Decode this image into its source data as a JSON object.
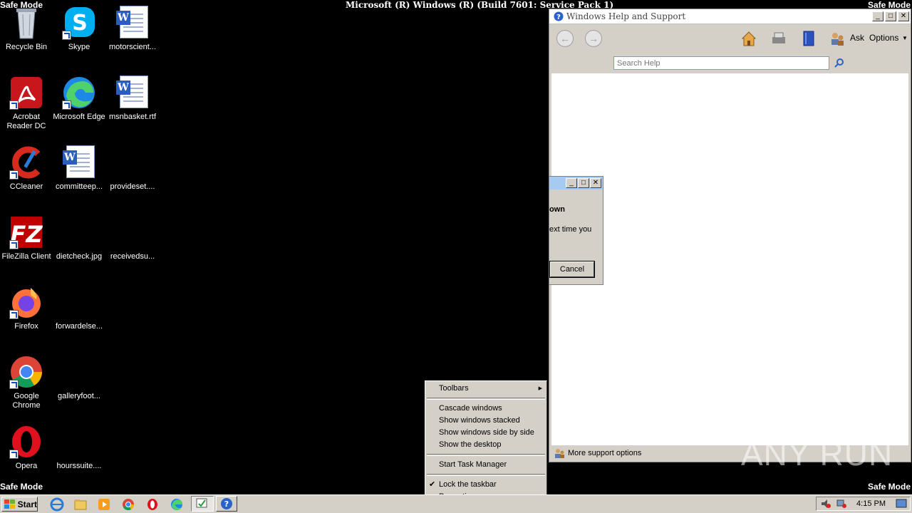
{
  "safe_mode": "Safe Mode",
  "build_text": "Microsoft (R) Windows (R) (Build 7601: Service Pack 1)",
  "desktop_icons": [
    {
      "label": "Recycle Bin"
    },
    {
      "label": "Skype"
    },
    {
      "label": "motorscient..."
    },
    {
      "label": "Acrobat\nReader DC"
    },
    {
      "label": "Microsoft Edge"
    },
    {
      "label": "msnbasket.rtf"
    },
    {
      "label": "CCleaner"
    },
    {
      "label": "committeep..."
    },
    {
      "label": "provideset...."
    },
    {
      "label": "FileZilla Client"
    },
    {
      "label": "dietcheck.jpg"
    },
    {
      "label": "receivedsu..."
    },
    {
      "label": "Firefox"
    },
    {
      "label": "forwardelse..."
    },
    {
      "label": "Google\nChrome"
    },
    {
      "label": "galleryfoot..."
    },
    {
      "label": "Opera"
    },
    {
      "label": "hourssuite...."
    }
  ],
  "help_window": {
    "title": "Windows Help and Support",
    "ask_label": "Ask",
    "options_label": "Options",
    "search_placeholder": "Search Help",
    "footer": "More support options"
  },
  "dialog": {
    "line1": "own",
    "line2": "ext time you",
    "cancel": "Cancel"
  },
  "context_menu": {
    "toolbars": "Toolbars",
    "cascade": "Cascade windows",
    "stacked": "Show windows stacked",
    "side_by_side": "Show windows side by side",
    "show_desktop": "Show the desktop",
    "task_manager": "Start Task Manager",
    "lock_taskbar": "Lock the taskbar",
    "properties": "Properties"
  },
  "taskbar": {
    "start": "Start",
    "clock": "4:15 PM"
  },
  "watermark": "ANY RUN"
}
